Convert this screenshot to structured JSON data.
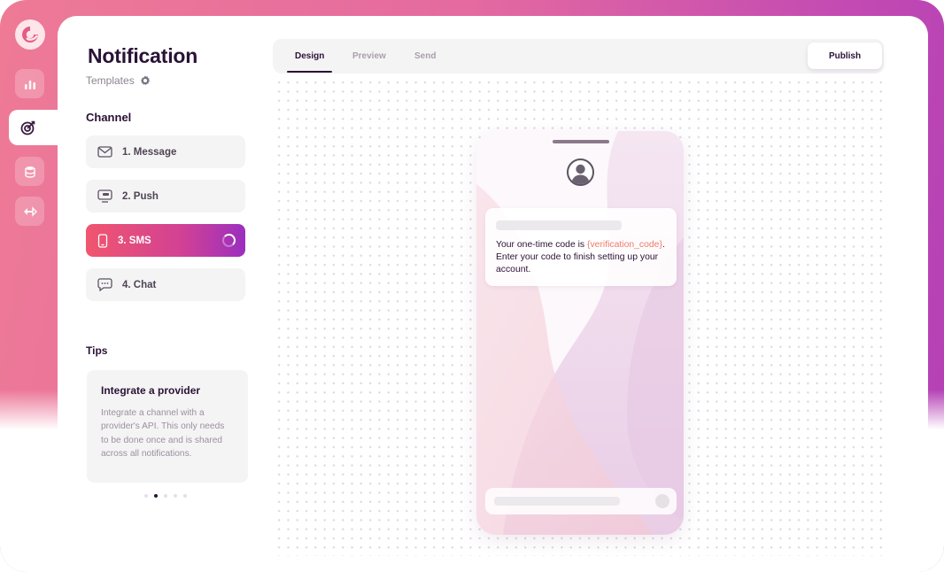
{
  "app": {
    "title": "Notification",
    "subtitle": "Templates"
  },
  "rail": {
    "icons": [
      "logo-icon",
      "chart-icon",
      "target-icon",
      "database-icon",
      "integration-icon"
    ],
    "active": "target-icon"
  },
  "channel": {
    "heading": "Channel",
    "items": [
      {
        "label": "1. Message",
        "icon": "envelope-icon"
      },
      {
        "label": "2. Push",
        "icon": "monitor-icon"
      },
      {
        "label": "3. SMS",
        "icon": "phone-icon",
        "active": true
      },
      {
        "label": "4. Chat",
        "icon": "chat-bubble-icon"
      }
    ]
  },
  "tips": {
    "heading": "Tips",
    "card_title": "Integrate a provider",
    "card_body": "Integrate a channel with a provider's API. This only needs to be done once and is shared across all notifications.",
    "pager_total": 5,
    "pager_active": 2
  },
  "tabs": {
    "items": [
      "Design",
      "Preview",
      "Send"
    ],
    "active": "Design"
  },
  "publish_label": "Publish",
  "preview": {
    "message_prefix": "Your one-time code is ",
    "message_variable": "{verification_code}",
    "message_suffix": ". Enter your code to finish setting up your account."
  },
  "colors": {
    "accent_start": "#f0566e",
    "accent_end": "#9b2fbf",
    "brand_bg": "#e46aa0",
    "variable_highlight": "#ef7a6a"
  }
}
